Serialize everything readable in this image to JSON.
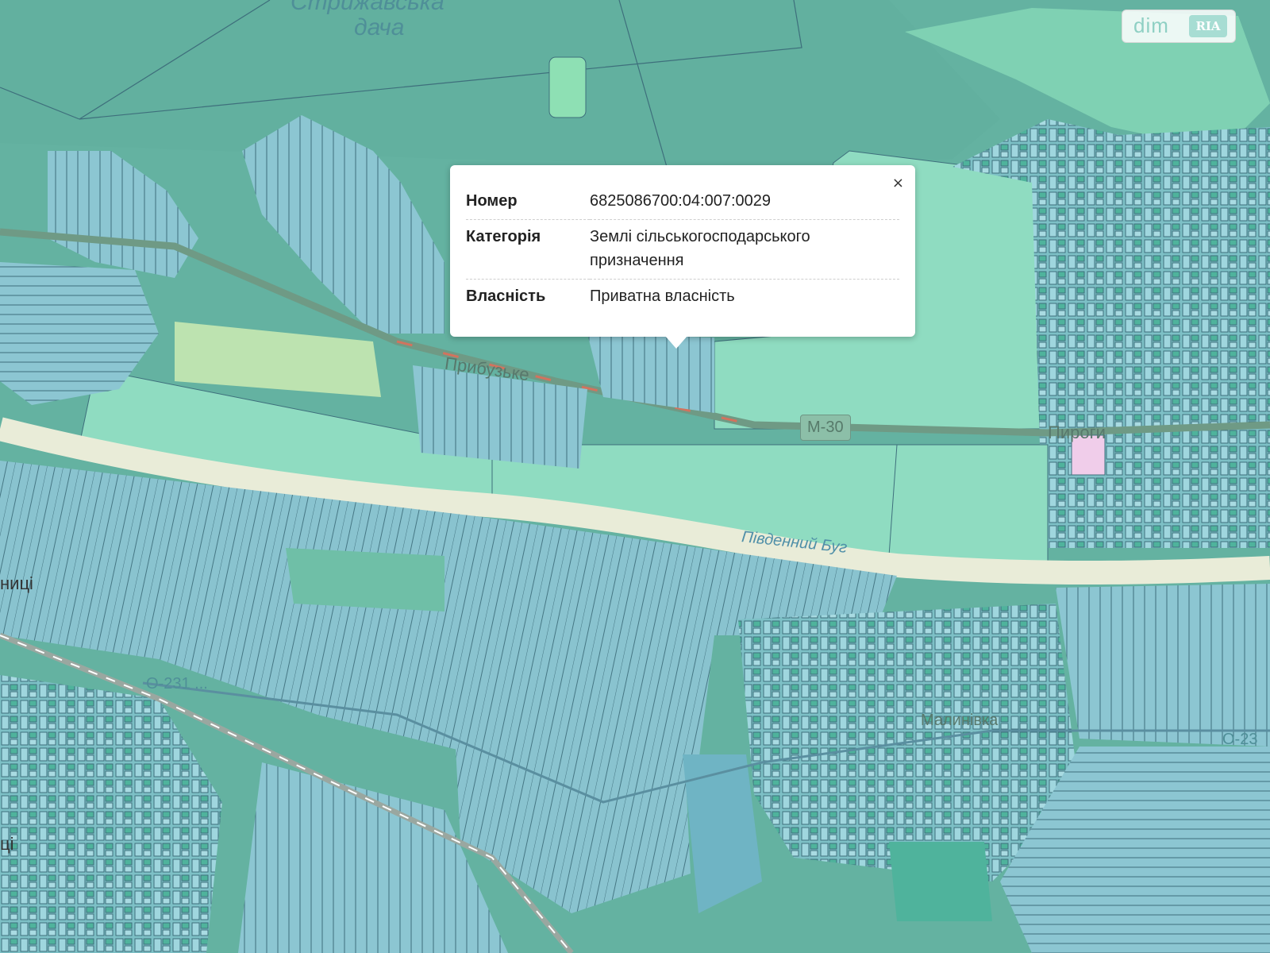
{
  "map": {
    "labels": {
      "forest": "Стрижавська",
      "forest2": "дача",
      "river": "Південний Буг",
      "village1": "Прибузьке",
      "village2": "Пироги",
      "village3": "Малинівка",
      "edge_left": "ниці",
      "edge_left2": "ці",
      "road_m30": "М-30",
      "road_o1": "О-231 ...",
      "road_o2": "О-23"
    }
  },
  "popup": {
    "close": "×",
    "rows": [
      {
        "key": "Номер",
        "value": "6825086700:04:007:0029"
      },
      {
        "key": "Категорія",
        "value": "Землі сільськогосподарського призначення"
      },
      {
        "key": "Власність",
        "value": "Приватна власність"
      }
    ]
  },
  "watermark": {
    "dim": "dim",
    "ria": "RIA"
  },
  "colors": {
    "forest": "#5fae9c",
    "parcel": "#86c3cf",
    "field": "#8fdcc1",
    "meadow": "#bde3b0",
    "river": "#e9ecd8",
    "road": "#6f9a85"
  }
}
